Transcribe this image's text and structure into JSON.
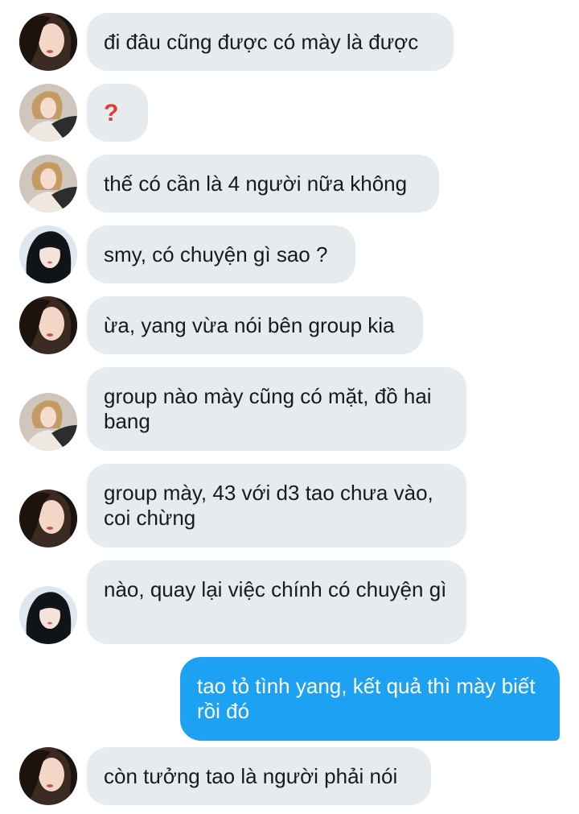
{
  "messages": [
    {
      "text": "đi đâu cũng được có mày là được"
    },
    {
      "text": "?"
    },
    {
      "text": "thế có cần là 4 người nữa không"
    },
    {
      "text": "smy, có chuyện gì sao ?"
    },
    {
      "text": "ừa, yang vừa nói bên group kia"
    },
    {
      "text": "group nào mày cũng có mặt, đồ hai bang"
    },
    {
      "text": "group mày, 43 với d3 tao chưa vào, coi chừng"
    },
    {
      "text": "nào, quay lại việc chính có chuyện gì"
    },
    {
      "text": "tao tỏ tình yang, kết quả thì mày biết rồi đó"
    },
    {
      "text": "còn tưởng tao là người phải nói"
    }
  ],
  "colors": {
    "received_bubble": "#e6ebf0",
    "sent_bubble": "#1da1f2",
    "question_mark": "#e53935"
  }
}
